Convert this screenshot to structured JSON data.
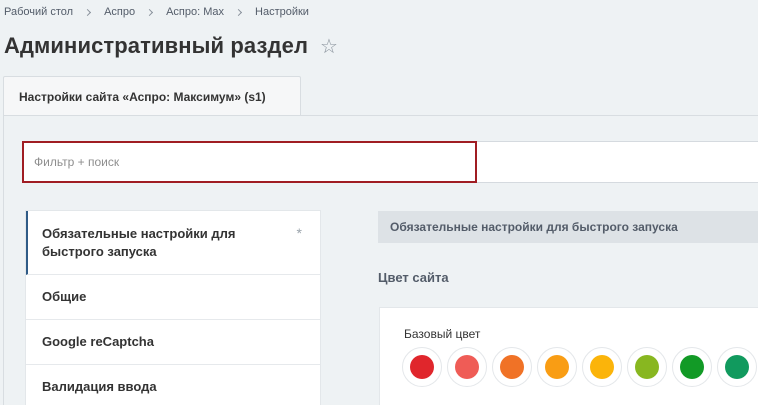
{
  "breadcrumb": [
    "Рабочий стол",
    "Аспро",
    "Аспро: Max",
    "Настройки"
  ],
  "page": {
    "title": "Административный раздел"
  },
  "tab": {
    "label": "Настройки сайта «Аспро: Максимум» (s1)"
  },
  "filter": {
    "placeholder": "Фильтр + поиск",
    "value": ""
  },
  "sidebar": {
    "items": [
      {
        "label": "Обязательные настройки для быстрого запуска",
        "mark": "*"
      },
      {
        "label": "Общие"
      },
      {
        "label": "Google reCaptcha"
      },
      {
        "label": "Валидация ввода"
      }
    ]
  },
  "section": {
    "header": "Обязательные настройки для быстрого запуска",
    "subtitle": "Цвет сайта",
    "base_color_label": "Базовый цвет",
    "swatches": [
      "#e0262c",
      "#ef5c56",
      "#f07226",
      "#f99d14",
      "#fbb40a",
      "#88b720",
      "#129a26",
      "#119a5e"
    ]
  },
  "icons": {
    "favorite": "star-outline-icon",
    "breadcrumb_separator": "chevron-right-icon"
  }
}
